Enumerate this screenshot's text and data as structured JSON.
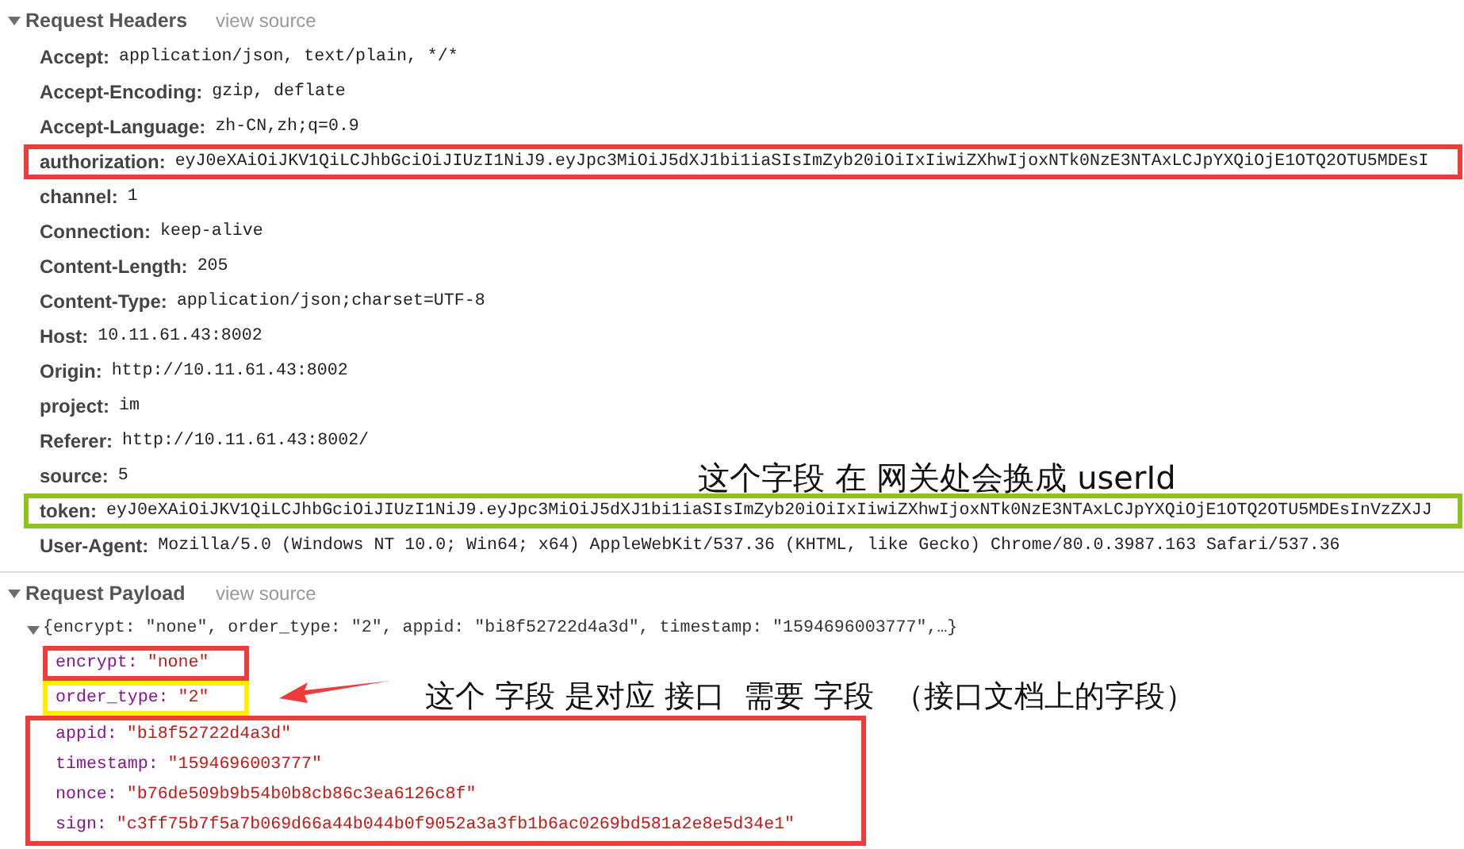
{
  "request_headers": {
    "title": "Request Headers",
    "view_source": "view source",
    "expanded": true,
    "headers": [
      {
        "name": "Accept:",
        "value": "application/json, text/plain, */*"
      },
      {
        "name": "Accept-Encoding:",
        "value": "gzip, deflate"
      },
      {
        "name": "Accept-Language:",
        "value": "zh-CN,zh;q=0.9"
      },
      {
        "name": "authorization:",
        "value": "eyJ0eXAiOiJKV1QiLCJhbGciOiJIUzI1NiJ9.eyJpc3MiOiJ5dXJ1bi1iaSIsImZyb20iOiIxIiwiZXhwIjoxNTk0NzE3NTAxLCJpYXQiOjE1OTQ2OTU5MDEsI",
        "color": "#f03b3b"
      },
      {
        "name": "channel:",
        "value": "1"
      },
      {
        "name": "Connection:",
        "value": "keep-alive"
      },
      {
        "name": "Content-Length:",
        "value": "205"
      },
      {
        "name": "Content-Type:",
        "value": "application/json;charset=UTF-8"
      },
      {
        "name": "Host:",
        "value": "10.11.61.43:8002"
      },
      {
        "name": "Origin:",
        "value": "http://10.11.61.43:8002"
      },
      {
        "name": "project:",
        "value": "im"
      },
      {
        "name": "Referer:",
        "value": "http://10.11.61.43:8002/"
      },
      {
        "name": "source:",
        "value": "5"
      },
      {
        "name": "token:",
        "value": "eyJ0eXAiOiJKV1QiLCJhbGciOiJIUzI1NiJ9.eyJpc3MiOiJ5dXJ1bi1iaSIsImZyb20iOiIxIiwiZXhwIjoxNTk0NzE3NTAxLCJpYXQiOjE1OTQ2OTU5MDEsInVzZXJJ",
        "color": "#8dc21f"
      },
      {
        "name": "User-Agent:",
        "value": "Mozilla/5.0 (Windows NT 10.0; Win64; x64) AppleWebKit/537.36 (KHTML, like Gecko) Chrome/80.0.3987.163 Safari/537.36"
      }
    ]
  },
  "request_payload": {
    "title": "Request Payload",
    "view_source": "view source",
    "expanded": true,
    "summary": "{encrypt: \"none\", order_type: \"2\", appid: \"bi8f52722d4a3d\", timestamp: \"1594696003777\",…}",
    "summary_expanded": true,
    "field_groups": [
      {
        "color": "#f03b3b",
        "fields": [
          {
            "key": "encrypt:",
            "value": "\"none\""
          }
        ]
      },
      {
        "color": "#ffee00",
        "fields": [
          {
            "key": "order_type:",
            "value": "\"2\""
          }
        ]
      },
      {
        "color": "#f03b3b",
        "fields": [
          {
            "key": "appid:",
            "value": "\"bi8f52722d4a3d\""
          },
          {
            "key": "timestamp:",
            "value": "\"1594696003777\""
          },
          {
            "key": "nonce:",
            "value": "\"b76de509b9b54b0b8cb86c3ea6126c8f\""
          },
          {
            "key": "sign:",
            "value": "\"c3ff75b7f5a7b069d66a44b044b0f9052a3a3fb1b6ac0269bd581a2e8e5d34e1\""
          }
        ]
      }
    ]
  },
  "annotations": [
    {
      "text": "这个字段 在 网关处会换成 userId"
    },
    {
      "text": "这个 字段 是对应 接口  需要 字段  （接口文档上的字段）"
    }
  ]
}
